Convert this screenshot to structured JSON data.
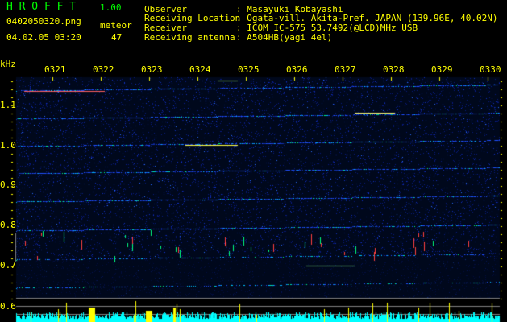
{
  "app": {
    "name": "H R O F F T",
    "version": "1.00"
  },
  "file": {
    "name": "0402050320.png",
    "datetime": "04.02.05 03:20"
  },
  "meteor": {
    "label": "meteor",
    "count": "47"
  },
  "info": [
    {
      "label": "Observer",
      "value": ": Masayuki Kobayashi"
    },
    {
      "label": "Receiving Location",
      "value": ": Ogata-vill. Akita-Pref. JAPAN (139.96E, 40.02N)"
    },
    {
      "label": "Receiver",
      "value": ": ICOM IC-575 53.7492(@LCD)MHz USB"
    },
    {
      "label": "Receiving antenna",
      "value": ": A504HB(yagi 4el)"
    }
  ],
  "axis": {
    "unit": "kHz",
    "y_ticks": [
      "1.1",
      "1.0",
      "0.9",
      "0.8",
      "0.7",
      "0.6"
    ],
    "time_ticks": [
      "0321",
      "0322",
      "0323",
      "0324",
      "0325",
      "0326",
      "0327",
      "0328",
      "0329",
      "0330"
    ]
  },
  "colors": {
    "background": "#000000",
    "text": "#ffff00",
    "title": "#00ff00",
    "noise": "#0a1a80",
    "histogram": "#00ffff",
    "meteor_bar": "#ffff00"
  }
}
